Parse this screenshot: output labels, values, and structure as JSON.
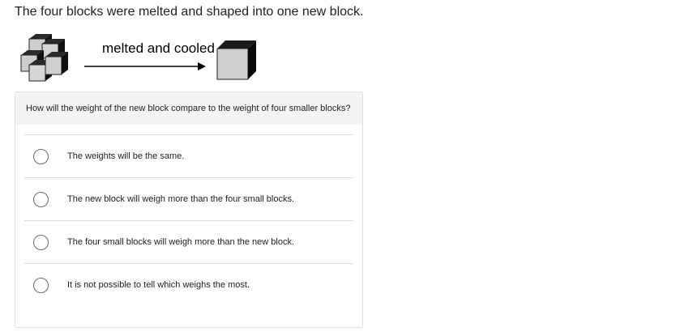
{
  "prompt": "The four blocks were melted and shaped into one new block.",
  "figure": {
    "caption": "melted and cooled",
    "left_image": "four-blocks-stacked",
    "right_image": "single-block",
    "arrow": "right-arrow"
  },
  "question": {
    "text": "How will the weight of the new block compare to the weight of four smaller blocks?",
    "choices": [
      {
        "label": "The weights will be the same.",
        "selected": false
      },
      {
        "label": "The new block will weigh more than the four small blocks.",
        "selected": false
      },
      {
        "label": "The four small blocks will weigh more than the new block.",
        "selected": false
      },
      {
        "label": "It is not possible to tell which weighs the most.",
        "selected": false
      }
    ]
  },
  "colors": {
    "header_bg": "#f4f4f4",
    "border": "#dcdcdc",
    "radio_border": "#6a6a6a"
  }
}
